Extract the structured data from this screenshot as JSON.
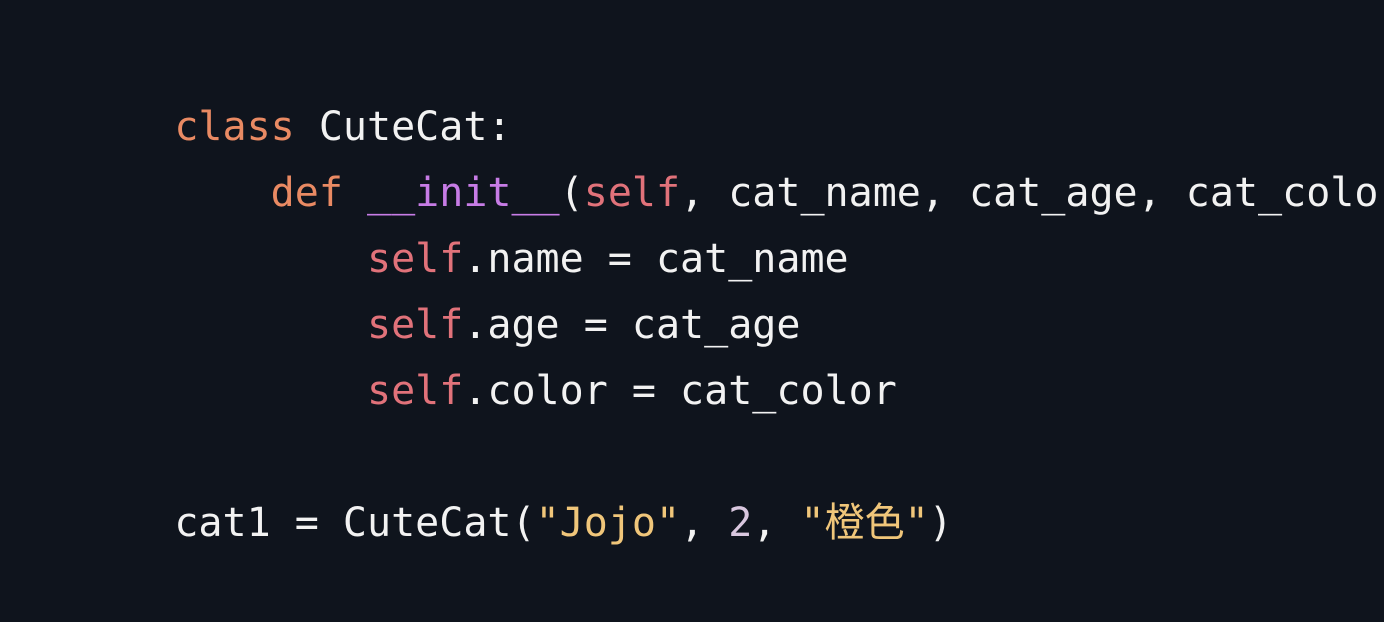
{
  "editor": {
    "lines": [
      {
        "tokens": [
          {
            "text": "class ",
            "kind": "kw"
          },
          {
            "text": "CuteCat:",
            "kind": "plain"
          }
        ]
      },
      {
        "tokens": [
          {
            "text": "    def ",
            "kind": "kw"
          },
          {
            "text": "__init__",
            "kind": "func"
          },
          {
            "text": "(",
            "kind": "plain"
          },
          {
            "text": "self",
            "kind": "selfkw"
          },
          {
            "text": ", cat_name, cat_age, cat_color):",
            "kind": "plain"
          }
        ]
      },
      {
        "tokens": [
          {
            "text": "        self",
            "kind": "selfkw"
          },
          {
            "text": ".name = cat_name",
            "kind": "plain"
          }
        ]
      },
      {
        "tokens": [
          {
            "text": "        self",
            "kind": "selfkw"
          },
          {
            "text": ".age = cat_age",
            "kind": "plain"
          }
        ]
      },
      {
        "tokens": [
          {
            "text": "        self",
            "kind": "selfkw"
          },
          {
            "text": ".color = cat_color",
            "kind": "plain"
          }
        ]
      },
      {
        "tokens": []
      },
      {
        "tokens": [
          {
            "text": "cat1 = CuteCat(",
            "kind": "plain"
          },
          {
            "text": "\"Jojo\"",
            "kind": "str"
          },
          {
            "text": ", ",
            "kind": "plain"
          },
          {
            "text": "2",
            "kind": "num"
          },
          {
            "text": ", ",
            "kind": "plain"
          },
          {
            "text": "\"橙色\"",
            "kind": "str"
          },
          {
            "text": ")",
            "kind": "plain"
          }
        ]
      }
    ]
  },
  "colors": {
    "background": "#0f141d",
    "keyword": "#e98a63",
    "self": "#e1727a",
    "function": "#c77ce6",
    "string": "#f0c67a",
    "number": "#d9c7df",
    "plain": "#f2f2f2"
  }
}
